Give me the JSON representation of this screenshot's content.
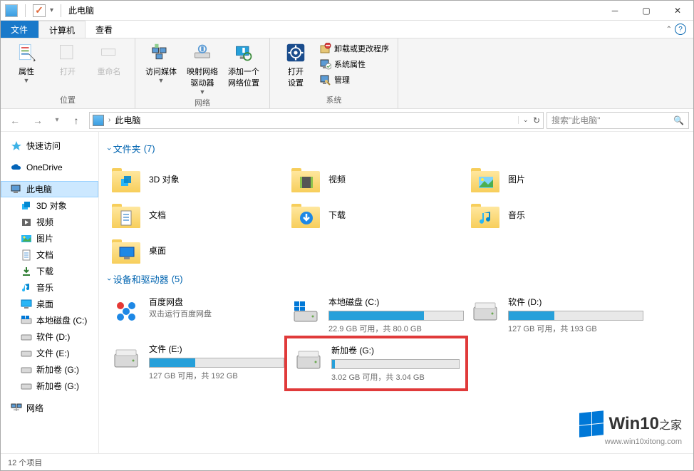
{
  "title": "此电脑",
  "tabs": {
    "file": "文件",
    "computer": "计算机",
    "view": "查看"
  },
  "ribbon": {
    "group1": {
      "label": "位置",
      "properties": "属性",
      "open": "打开",
      "rename": "重命名"
    },
    "group2": {
      "label": "网络",
      "media": "访问媒体",
      "map": "映射网络\n驱动器",
      "addloc": "添加一个\n网络位置"
    },
    "group3": {
      "label": "系统",
      "openSettings": "打开\n设置",
      "uninstall": "卸载或更改程序",
      "sysprops": "系统属性",
      "manage": "管理"
    }
  },
  "addr": {
    "location": "此电脑",
    "searchPlaceholder": "搜索\"此电脑\""
  },
  "sidebar": {
    "quick": "快速访问",
    "onedrive": "OneDrive",
    "thispc": "此电脑",
    "items": [
      "3D 对象",
      "视频",
      "图片",
      "文档",
      "下载",
      "音乐",
      "桌面",
      "本地磁盘 (C:)",
      "软件 (D:)",
      "文件 (E:)",
      "新加卷 (G:)",
      "新加卷 (G:)"
    ],
    "network": "网络"
  },
  "sections": {
    "folders": {
      "title": "文件夹",
      "count": "(7)"
    },
    "drives": {
      "title": "设备和驱动器",
      "count": "(5)"
    }
  },
  "folders": [
    {
      "name": "3D 对象",
      "type": "3d"
    },
    {
      "name": "视频",
      "type": "video"
    },
    {
      "name": "图片",
      "type": "picture"
    },
    {
      "name": "文档",
      "type": "document"
    },
    {
      "name": "下载",
      "type": "download"
    },
    {
      "name": "音乐",
      "type": "music"
    },
    {
      "name": "桌面",
      "type": "desktop"
    }
  ],
  "drives": [
    {
      "name": "百度网盘",
      "sub": "双击运行百度网盘",
      "pct": 0,
      "special": "baidu"
    },
    {
      "name": "本地磁盘 (C:)",
      "sub": "22.9 GB 可用，共 80.0 GB",
      "pct": 71,
      "special": "windows"
    },
    {
      "name": "软件 (D:)",
      "sub": "127 GB 可用，共 193 GB",
      "pct": 34
    },
    {
      "name": "文件 (E:)",
      "sub": "127 GB 可用，共 192 GB",
      "pct": 34
    },
    {
      "name": "新加卷 (G:)",
      "sub": "3.02 GB 可用，共 3.04 GB",
      "pct": 2,
      "highlight": true
    }
  ],
  "status": "12 个项目",
  "watermark": {
    "title": "Win10",
    "sub": "之家",
    "url": "www.win10xitong.com"
  }
}
